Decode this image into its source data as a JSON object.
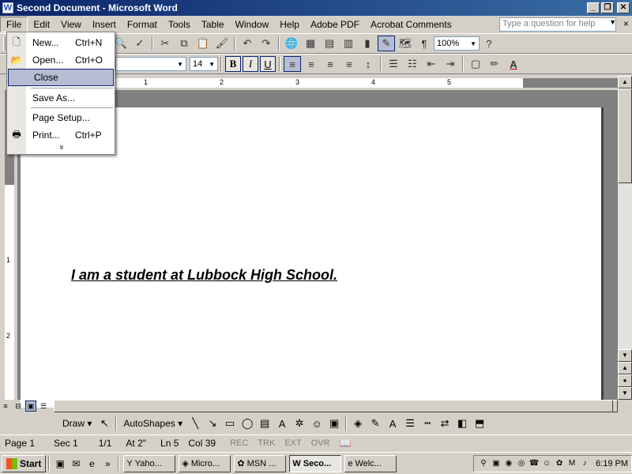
{
  "window": {
    "title": "Second Document - Microsoft Word",
    "app_icon": "W",
    "controls": [
      "_",
      "❐",
      "✕"
    ]
  },
  "menubar": {
    "items": [
      "File",
      "Edit",
      "View",
      "Insert",
      "Format",
      "Tools",
      "Table",
      "Window",
      "Help",
      "Adobe PDF",
      "Acrobat Comments"
    ],
    "active": "File",
    "ask_placeholder": "Type a question for help",
    "doc_close": "×"
  },
  "file_menu": {
    "items": [
      {
        "label": "New...",
        "shortcut": "Ctrl+N",
        "icon": "new-document-icon",
        "glyph": "🗋"
      },
      {
        "label": "Open...",
        "shortcut": "Ctrl+O",
        "icon": "open-folder-icon",
        "glyph": "📂"
      },
      {
        "label": "Close",
        "shortcut": "",
        "icon": "",
        "glyph": "",
        "highlighted": true
      },
      {
        "label": "Save As...",
        "shortcut": "",
        "icon": "",
        "glyph": ""
      },
      {
        "label": "Page Setup...",
        "shortcut": "",
        "icon": "",
        "glyph": ""
      },
      {
        "label": "Print...",
        "shortcut": "Ctrl+P",
        "icon": "printer-icon",
        "glyph": "🖶"
      }
    ],
    "more": "»"
  },
  "standard_toolbar": {
    "zoom": "100%",
    "help_icon": "?"
  },
  "formatting_toolbar": {
    "font_size": "14",
    "bold": "B",
    "italic": "I",
    "underline": "U"
  },
  "ruler": {
    "numbers": [
      "1",
      "2",
      "3",
      "4",
      "5"
    ]
  },
  "vertical_ruler": {
    "numbers": [
      "1",
      "2"
    ]
  },
  "document": {
    "text": "I am a student at Lubbock High School."
  },
  "draw_toolbar": {
    "draw": "Draw ▾",
    "autoshapes": "AutoShapes ▾"
  },
  "statusbar": {
    "page": "Page  1",
    "section": "Sec  1",
    "pages": "1/1",
    "at": "At  2\"",
    "line": "Ln  5",
    "col": "Col  39",
    "rec": "REC",
    "trk": "TRK",
    "ext": "EXT",
    "ovr": "OVR"
  },
  "taskbar": {
    "start": "Start",
    "tasks": [
      {
        "label": "Yaho...",
        "icon": "Y",
        "active": false
      },
      {
        "label": "Micro...",
        "icon": "◈",
        "active": false
      },
      {
        "label": "MSN ...",
        "icon": "✿",
        "active": false
      },
      {
        "label": "Seco...",
        "icon": "W",
        "active": true
      },
      {
        "label": "Welc...",
        "icon": "e",
        "active": false
      }
    ],
    "clock": "6:19 PM"
  },
  "colors": {
    "title_start": "#0a246a",
    "title_end": "#3a6ea5",
    "chrome": "#d4d0c8",
    "menu_highlight": "#b6bdd2"
  }
}
